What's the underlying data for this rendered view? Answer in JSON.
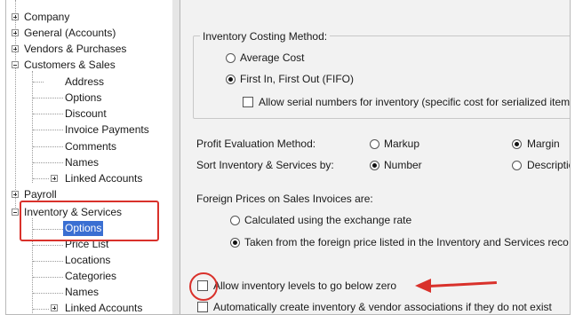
{
  "tree": {
    "items": [
      {
        "label": "Company"
      },
      {
        "label": "General (Accounts)"
      },
      {
        "label": "Vendors & Purchases"
      },
      {
        "label": "Customers & Sales"
      },
      {
        "label": "Address"
      },
      {
        "label": "Options"
      },
      {
        "label": "Discount"
      },
      {
        "label": "Invoice Payments"
      },
      {
        "label": "Comments"
      },
      {
        "label": "Names"
      },
      {
        "label": "Linked Accounts"
      },
      {
        "label": "Payroll"
      },
      {
        "label": "Inventory & Services"
      },
      {
        "label": "Options"
      },
      {
        "label": "Price List"
      },
      {
        "label": "Locations"
      },
      {
        "label": "Categories"
      },
      {
        "label": "Names"
      },
      {
        "label": "Linked Accounts"
      }
    ]
  },
  "settings": {
    "costing": {
      "label": "Inventory Costing Method:",
      "average_cost": "Average Cost",
      "fifo": "First In, First Out (FIFO)",
      "serial": "Allow serial numbers for inventory (specific cost for serialized items"
    },
    "profit": {
      "label": "Profit Evaluation Method:",
      "markup": "Markup",
      "margin": "Margin"
    },
    "sort": {
      "label": "Sort Inventory & Services by:",
      "number": "Number",
      "description": "Descriptio"
    },
    "foreign": {
      "label": "Foreign Prices on Sales Invoices are:",
      "calculated": "Calculated using the exchange rate",
      "taken": "Taken from the foreign price listed in the Inventory and Services reco"
    },
    "below_zero": "Allow inventory levels to go below zero",
    "auto_create": "Automatically create inventory & vendor associations if they do not exist"
  }
}
